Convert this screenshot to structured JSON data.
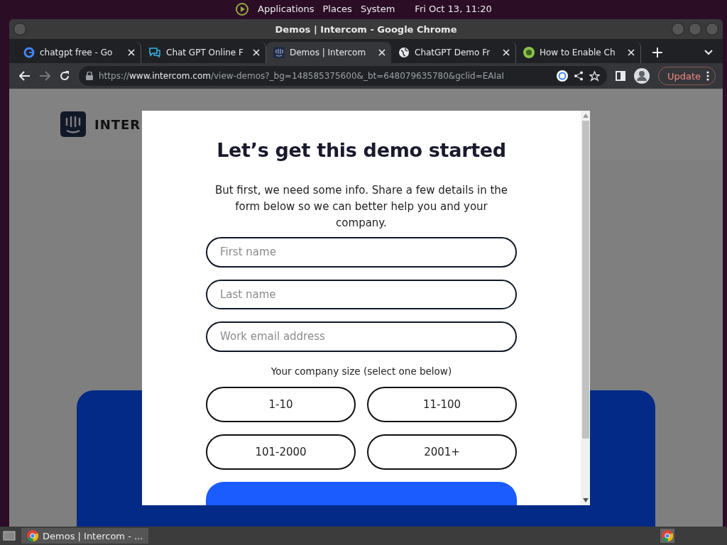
{
  "top_panel": {
    "menus": [
      "Applications",
      "Places",
      "System"
    ],
    "clock": "Fri Oct 13, 11:20"
  },
  "window": {
    "title": "Demos | Intercom - Google Chrome"
  },
  "tabs": [
    {
      "title": "chatgpt free - Go",
      "kind": "google",
      "selected": false
    },
    {
      "title": "Chat GPT Online F",
      "kind": "chat",
      "selected": false
    },
    {
      "title": "Demos | Intercom",
      "kind": "intercom",
      "selected": true
    },
    {
      "title": "ChatGPT Demo Fr",
      "kind": "globe",
      "selected": false
    },
    {
      "title": "How to Enable Ch",
      "kind": "leaf",
      "selected": false
    }
  ],
  "address_bar": {
    "url_prefix": "https://",
    "url_domain": "www.intercom.com",
    "url_path": "/view-demos?_bg=148585375600&_bt=648079635780&gclid=EAIaI"
  },
  "update_button": "Update",
  "page": {
    "logo_text": "INTER"
  },
  "dialog": {
    "title": "Let’s get this demo started",
    "intro": "But first, we need some info. Share a few details in the form below so we can better help you and your company.",
    "fields": [
      {
        "placeholder": "First name"
      },
      {
        "placeholder": "Last name"
      },
      {
        "placeholder": "Work email address"
      }
    ],
    "size_label": "Your company size (select one below)",
    "sizes": [
      {
        "label": "1-10",
        "selected": false
      },
      {
        "label": "11-100",
        "selected": false
      },
      {
        "label": "101-2000",
        "selected": false
      },
      {
        "label": "2001+",
        "selected": false
      }
    ]
  },
  "taskbar": {
    "task": "Demos | Intercom - ..."
  }
}
